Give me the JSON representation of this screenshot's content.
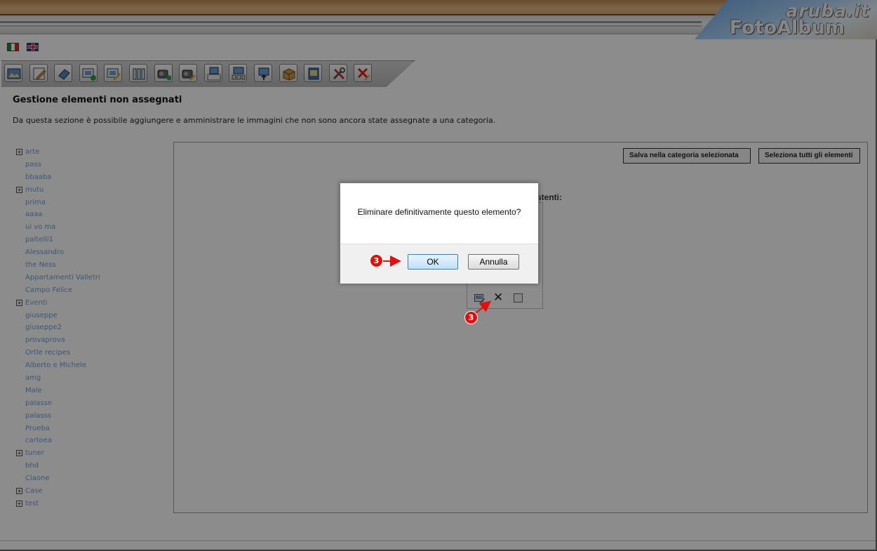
{
  "header": {
    "brand": "aruba.it",
    "product": "FotoAlbum"
  },
  "languages": [
    {
      "icon": "flag-italy-icon"
    },
    {
      "icon": "flag-uk-icon"
    }
  ],
  "toolbar": {
    "icons": [
      "gallery-icon",
      "edit-icon",
      "eraser-icon",
      "add-image-icon",
      "edit-image-icon",
      "sort-icon",
      "video-add-icon",
      "video-edit-icon",
      "slideshow-icon",
      "category-icon",
      "upload-icon",
      "package-icon",
      "album-icon",
      "tools-icon",
      "delete-icon"
    ]
  },
  "page": {
    "title": "Gestione elementi non assegnati",
    "description": "Da questa sezione è possibile aggiungere e amministrare le immagini che non sono ancora state assegnate a una categoria."
  },
  "categories": [
    {
      "label": "arte",
      "expandable": true
    },
    {
      "label": "pass",
      "expandable": false
    },
    {
      "label": "bbaaba",
      "expandable": false
    },
    {
      "label": "mutu",
      "expandable": true
    },
    {
      "label": "prima",
      "expandable": false
    },
    {
      "label": "aaaa",
      "expandable": false
    },
    {
      "label": "ui vo ma",
      "expandable": false
    },
    {
      "label": "paltelli1",
      "expandable": false
    },
    {
      "label": "Alessandro",
      "expandable": false
    },
    {
      "label": "the Ness",
      "expandable": false
    },
    {
      "label": "Appartamenti Valletri",
      "expandable": false
    },
    {
      "label": "Campo Felice",
      "expandable": false
    },
    {
      "label": "Eventi",
      "expandable": true
    },
    {
      "label": "giuseppe",
      "expandable": false
    },
    {
      "label": "giuseppe2",
      "expandable": false
    },
    {
      "label": "provaprova",
      "expandable": false
    },
    {
      "label": "Ortle recipes",
      "expandable": false
    },
    {
      "label": "Alberto e Michele",
      "expandable": false
    },
    {
      "label": "amg",
      "expandable": false
    },
    {
      "label": "Male",
      "expandable": false
    },
    {
      "label": "palasse",
      "expandable": false
    },
    {
      "label": "palasss",
      "expandable": false
    },
    {
      "label": "Prueba",
      "expandable": false
    },
    {
      "label": "cartoea",
      "expandable": false
    },
    {
      "label": "tuner",
      "expandable": true
    },
    {
      "label": "bhd",
      "expandable": false
    },
    {
      "label": "Ciaone",
      "expandable": false
    },
    {
      "label": "Case",
      "expandable": true
    },
    {
      "label": "test",
      "expandable": true
    }
  ],
  "actions": {
    "save_to_category": "Salva nella categoria selezionata",
    "select_all": "Seleziona tutti gli elementi"
  },
  "content": {
    "section_label": "stenti:"
  },
  "item_card": {
    "icons": [
      "edit-image-icon",
      "close-icon",
      "checkbox"
    ]
  },
  "dialog": {
    "message": "Eliminare definitivamente questo elemento?",
    "ok_label": "OK",
    "cancel_label": "Annulla"
  },
  "step_markers": [
    {
      "label": "3"
    },
    {
      "label": "3"
    }
  ],
  "colors": {
    "overlay": "#000000",
    "marker": "#e01010",
    "link": "#6aa0d8",
    "header_band": "#d7a978"
  }
}
